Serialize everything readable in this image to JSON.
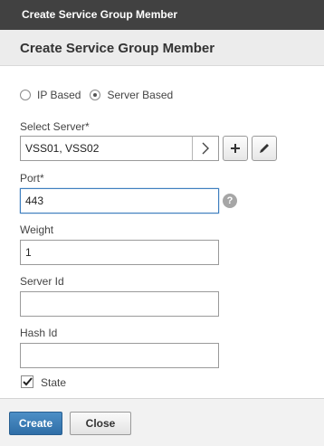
{
  "window": {
    "title": "Create Service Group Member"
  },
  "dialog": {
    "heading": "Create Service Group Member"
  },
  "member_type": {
    "options": [
      {
        "label": "IP Based",
        "selected": false
      },
      {
        "label": "Server Based",
        "selected": true
      }
    ]
  },
  "select_server": {
    "label": "Select Server*",
    "value": "VSS01, VSS02"
  },
  "port": {
    "label": "Port*",
    "value": "443"
  },
  "weight": {
    "label": "Weight",
    "value": "1"
  },
  "server_id": {
    "label": "Server Id",
    "value": ""
  },
  "hash_id": {
    "label": "Hash Id",
    "value": ""
  },
  "state": {
    "label": "State",
    "checked": true
  },
  "buttons": {
    "create": "Create",
    "close": "Close"
  },
  "help": {
    "glyph": "?"
  },
  "icons": [
    "chevron-right-icon",
    "plus-icon",
    "pencil-icon",
    "help-icon",
    "checkmark-icon"
  ],
  "colors": {
    "titlebar": "#414141",
    "primary_button": "#3a7ab5",
    "focus_border": "#3f7fbf"
  }
}
